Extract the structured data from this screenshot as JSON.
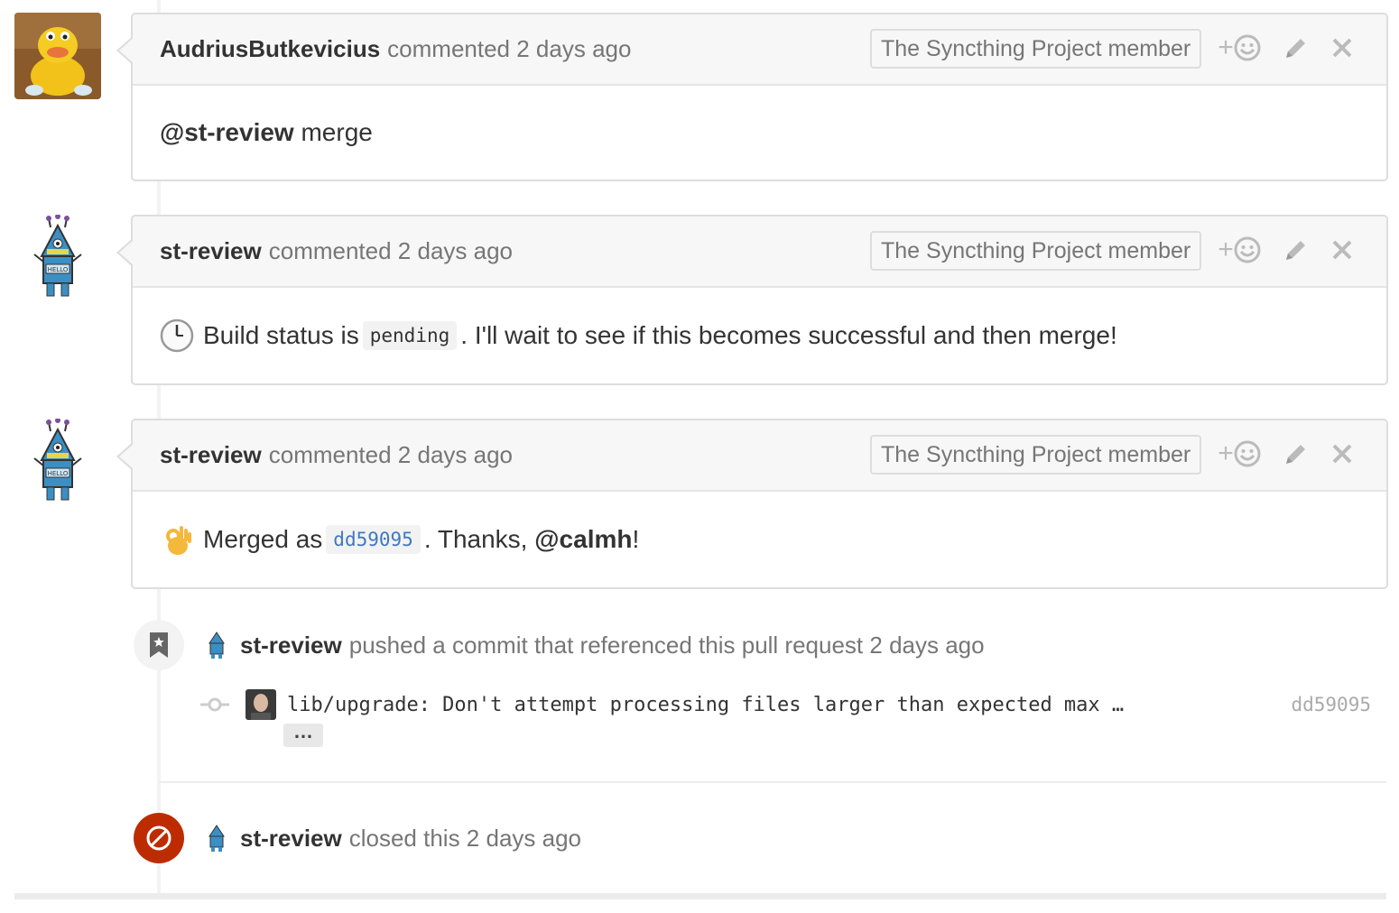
{
  "comments": [
    {
      "author": "AudriusButkevicius",
      "meta": "commented 2 days ago",
      "badge": "The Syncthing Project member",
      "mention": "@st-review",
      "text": " merge"
    },
    {
      "author": "st-review",
      "meta": "commented 2 days ago",
      "badge": "The Syncthing Project member",
      "emoji": "clock-icon",
      "text_before": "Build status is",
      "code": "pending",
      "text_after": ". I'll wait to see if this becomes successful and then merge!"
    },
    {
      "author": "st-review",
      "meta": "commented 2 days ago",
      "badge": "The Syncthing Project member",
      "emoji": "ok-hand-icon",
      "text_before": "Merged as",
      "code": "dd59095",
      "text_mid": ". Thanks, ",
      "mention": "@calmh",
      "text_after": "!"
    }
  ],
  "actions": {
    "react": "+",
    "icons": [
      "smiley-icon",
      "pencil-icon",
      "close-icon"
    ]
  },
  "events": {
    "pushed": {
      "author": "st-review",
      "text": "pushed a commit that referenced this pull request 2 days ago",
      "icon": "bookmark-icon",
      "commit_message": "lib/upgrade: Don't attempt processing files larger than expected max …",
      "commit_sha": "dd59095",
      "expand_label": "…"
    },
    "closed": {
      "author": "st-review",
      "text": "closed this 2 days ago",
      "icon": "circle-slash-icon",
      "color": "#bd2c00"
    }
  }
}
